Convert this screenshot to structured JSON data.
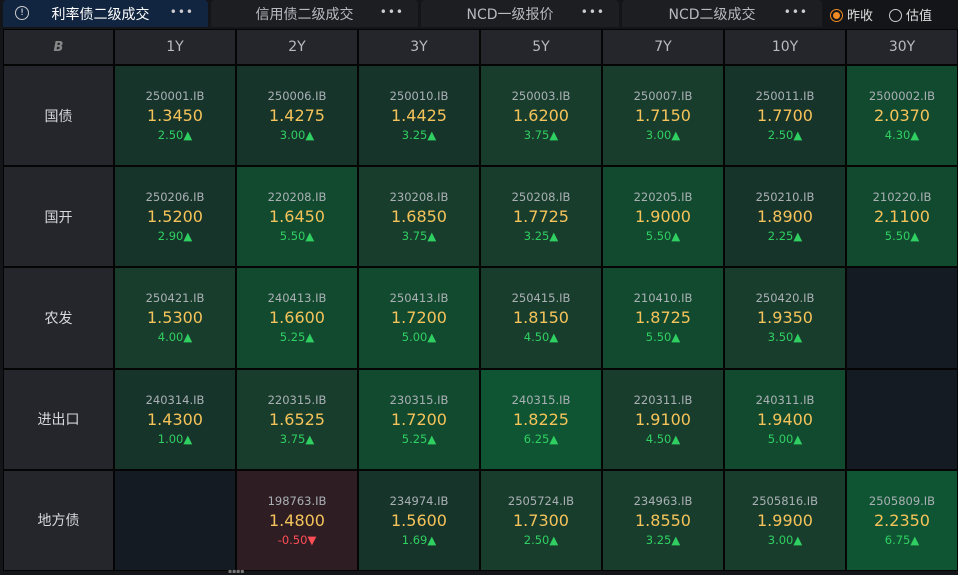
{
  "tabs": [
    {
      "label": "利率债二级成交",
      "active": true
    },
    {
      "label": "信用债二级成交"
    },
    {
      "label": "NCD一级报价"
    },
    {
      "label": "NCD二级成交"
    }
  ],
  "radio": {
    "options": [
      "昨收",
      "估值"
    ],
    "selected": "昨收"
  },
  "corner": "B",
  "columns": [
    "1Y",
    "2Y",
    "3Y",
    "5Y",
    "7Y",
    "10Y",
    "30Y"
  ],
  "rows": [
    {
      "label": "国债",
      "cells": [
        {
          "code": "250001.IB",
          "yield": "1.3450",
          "chg": "2.50▲",
          "tone": 0
        },
        {
          "code": "250006.IB",
          "yield": "1.4275",
          "chg": "3.00▲",
          "tone": 0
        },
        {
          "code": "250010.IB",
          "yield": "1.4425",
          "chg": "3.25▲",
          "tone": 0
        },
        {
          "code": "250003.IB",
          "yield": "1.6200",
          "chg": "3.75▲",
          "tone": 1
        },
        {
          "code": "250007.IB",
          "yield": "1.7150",
          "chg": "3.00▲",
          "tone": 1
        },
        {
          "code": "250011.IB",
          "yield": "1.7700",
          "chg": "2.50▲",
          "tone": 0
        },
        {
          "code": "2500002.IB",
          "yield": "2.0370",
          "chg": "4.30▲",
          "tone": 2
        }
      ]
    },
    {
      "label": "国开",
      "cells": [
        {
          "code": "250206.IB",
          "yield": "1.5200",
          "chg": "2.90▲",
          "tone": 0
        },
        {
          "code": "220208.IB",
          "yield": "1.6450",
          "chg": "5.50▲",
          "tone": 2
        },
        {
          "code": "230208.IB",
          "yield": "1.6850",
          "chg": "3.75▲",
          "tone": 1
        },
        {
          "code": "250208.IB",
          "yield": "1.7725",
          "chg": "3.25▲",
          "tone": 1
        },
        {
          "code": "220205.IB",
          "yield": "1.9000",
          "chg": "5.50▲",
          "tone": 2
        },
        {
          "code": "250210.IB",
          "yield": "1.8900",
          "chg": "2.25▲",
          "tone": 0
        },
        {
          "code": "210220.IB",
          "yield": "2.1100",
          "chg": "5.50▲",
          "tone": 2
        }
      ]
    },
    {
      "label": "农发",
      "cells": [
        {
          "code": "250421.IB",
          "yield": "1.5300",
          "chg": "4.00▲",
          "tone": 1
        },
        {
          "code": "240413.IB",
          "yield": "1.6600",
          "chg": "5.25▲",
          "tone": 2
        },
        {
          "code": "250413.IB",
          "yield": "1.7200",
          "chg": "5.00▲",
          "tone": 2
        },
        {
          "code": "250415.IB",
          "yield": "1.8150",
          "chg": "4.50▲",
          "tone": 1
        },
        {
          "code": "210410.IB",
          "yield": "1.8725",
          "chg": "5.50▲",
          "tone": 2
        },
        {
          "code": "250420.IB",
          "yield": "1.9350",
          "chg": "3.50▲",
          "tone": 1
        },
        null
      ]
    },
    {
      "label": "进出口",
      "cells": [
        {
          "code": "240314.IB",
          "yield": "1.4300",
          "chg": "1.00▲",
          "tone": 0
        },
        {
          "code": "220315.IB",
          "yield": "1.6525",
          "chg": "3.75▲",
          "tone": 1
        },
        {
          "code": "230315.IB",
          "yield": "1.7200",
          "chg": "5.25▲",
          "tone": 2
        },
        {
          "code": "240315.IB",
          "yield": "1.8225",
          "chg": "6.25▲",
          "tone": 3
        },
        {
          "code": "220311.IB",
          "yield": "1.9100",
          "chg": "4.50▲",
          "tone": 1
        },
        {
          "code": "240311.IB",
          "yield": "1.9400",
          "chg": "5.00▲",
          "tone": 2
        },
        null
      ]
    },
    {
      "label": "地方债",
      "cells": [
        null,
        {
          "code": "198763.IB",
          "yield": "1.4800",
          "chg": "-0.50▼",
          "tone": "neg"
        },
        {
          "code": "234974.IB",
          "yield": "1.5600",
          "chg": "1.69▲",
          "tone": 0
        },
        {
          "code": "2505724.IB",
          "yield": "1.7300",
          "chg": "2.50▲",
          "tone": 1
        },
        {
          "code": "234963.IB",
          "yield": "1.8550",
          "chg": "3.25▲",
          "tone": 1
        },
        {
          "code": "2505816.IB",
          "yield": "1.9900",
          "chg": "3.00▲",
          "tone": 1
        },
        {
          "code": "2505809.IB",
          "yield": "2.2350",
          "chg": "6.75▲",
          "tone": 3
        }
      ]
    }
  ]
}
